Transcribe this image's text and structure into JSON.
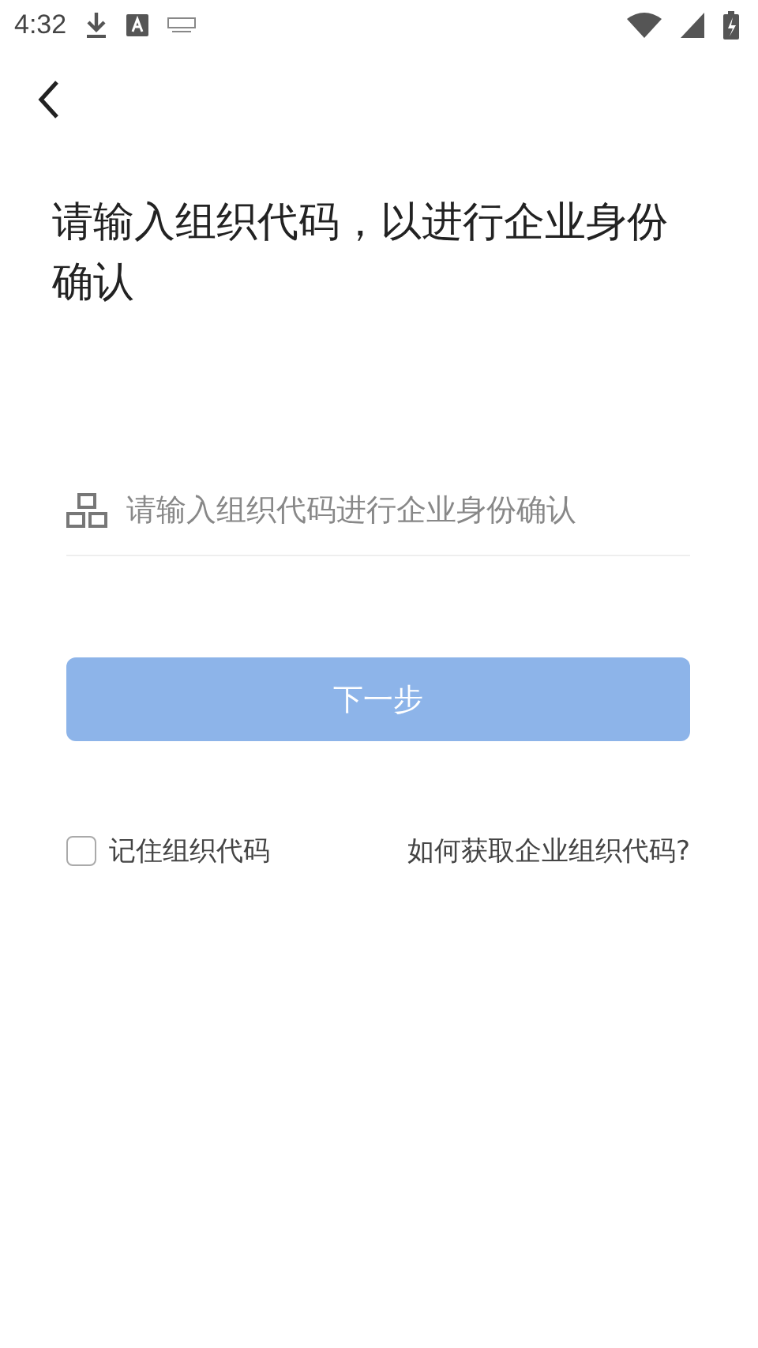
{
  "status_bar": {
    "time": "4:32"
  },
  "heading": "请输入组织代码，以进行企业身份确认",
  "org_code_field": {
    "placeholder": "请输入组织代码进行企业身份确认"
  },
  "next_button": {
    "label": "下一步",
    "disabled": true
  },
  "remember": {
    "label": "记住组织代码",
    "checked": false
  },
  "help_link": "如何获取企业组织代码?"
}
